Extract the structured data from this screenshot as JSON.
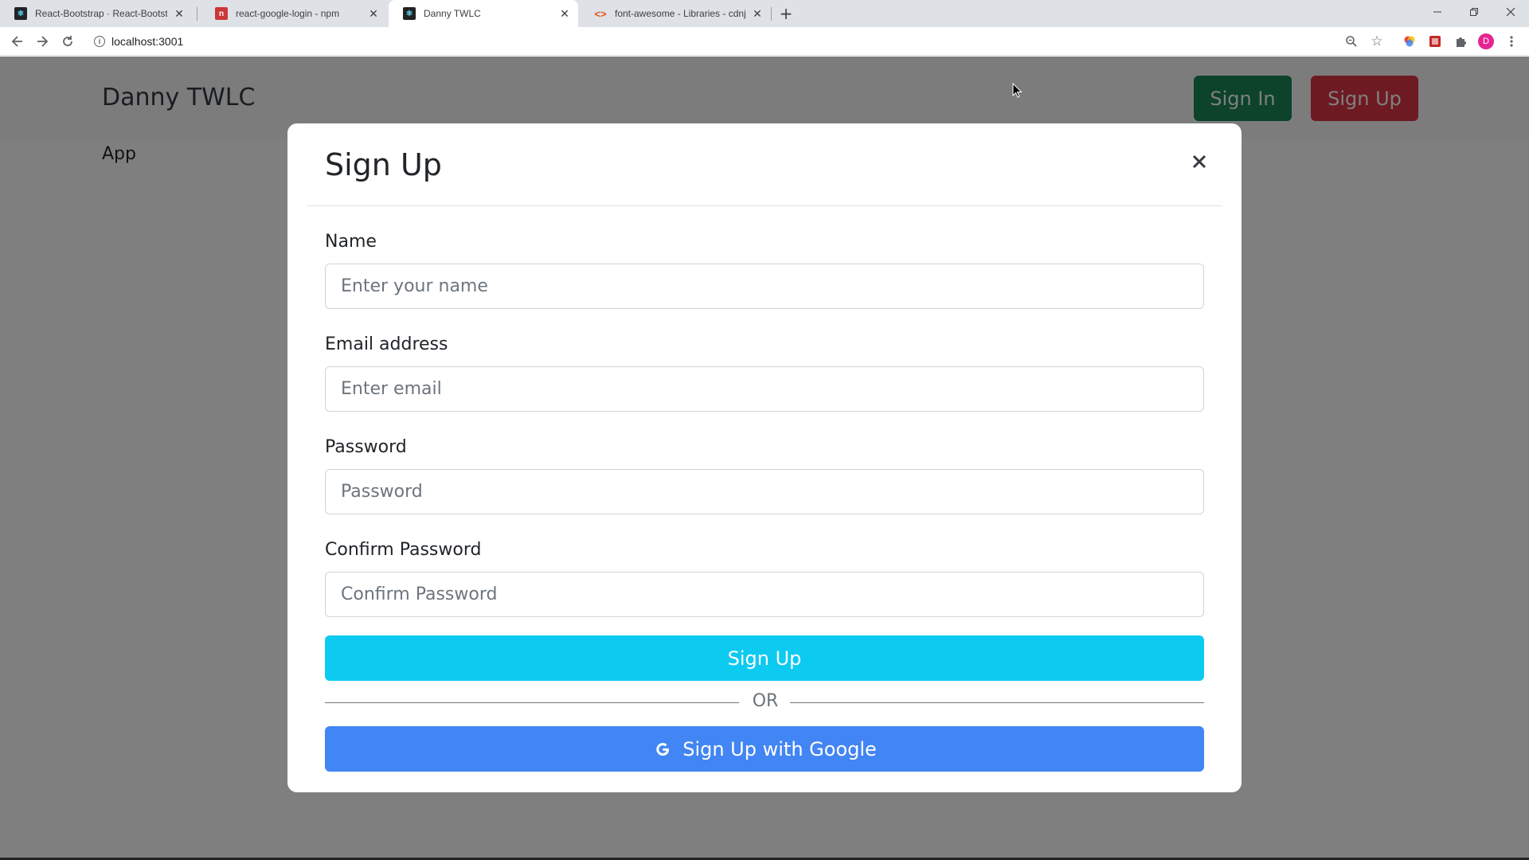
{
  "browser": {
    "tabs": [
      {
        "title": "React-Bootstrap · React-Bootstrap",
        "active": false
      },
      {
        "title": "react-google-login - npm",
        "active": false
      },
      {
        "title": "Danny TWLC",
        "active": true
      },
      {
        "title": "font-awesome - Libraries - cdnjs",
        "active": false
      }
    ],
    "url": "localhost:3001",
    "profile_initial": "D"
  },
  "navbar": {
    "brand": "Danny TWLC",
    "sign_in_label": "Sign In",
    "sign_up_label": "Sign Up"
  },
  "main": {
    "text": "App"
  },
  "modal": {
    "title": "Sign Up",
    "fields": [
      {
        "label": "Name",
        "placeholder": "Enter your name"
      },
      {
        "label": "Email address",
        "placeholder": "Enter email"
      },
      {
        "label": "Password",
        "placeholder": "Password"
      },
      {
        "label": "Confirm Password",
        "placeholder": "Confirm Password"
      }
    ],
    "submit_label": "Sign Up",
    "divider_text": "OR",
    "google_label": "Sign Up with Google"
  },
  "colors": {
    "sign_in": "#198754",
    "sign_up": "#dc3545",
    "submit": "#0dcaf0",
    "google": "#4285f4"
  }
}
